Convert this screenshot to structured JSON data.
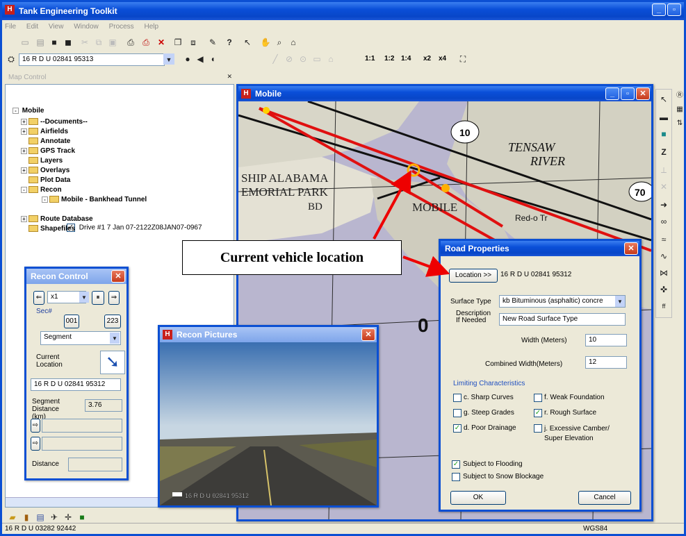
{
  "app": {
    "title": "Tank Engineering Toolkit",
    "menus": [
      "File",
      "Edit",
      "View",
      "Window",
      "Process",
      "Help"
    ]
  },
  "toolbar": {
    "coord_combo": "16 R D U 02841 95313",
    "scale_buttons": [
      "1:1",
      "1:2",
      "1:4",
      "x2",
      "x4"
    ]
  },
  "tree": {
    "header": "Map Control",
    "root": "Mobile",
    "items": [
      {
        "label": "--Documents--",
        "indent": 1,
        "expander": "+"
      },
      {
        "label": "Airfields",
        "indent": 1,
        "expander": "+"
      },
      {
        "label": "Annotate",
        "indent": 1,
        "expander": ""
      },
      {
        "label": "GPS Track",
        "indent": 1,
        "expander": "+"
      },
      {
        "label": "Layers",
        "indent": 1,
        "expander": ""
      },
      {
        "label": "Overlays",
        "indent": 1,
        "expander": "+"
      },
      {
        "label": "Plot Data",
        "indent": 1,
        "expander": ""
      },
      {
        "label": "Recon",
        "indent": 1,
        "expander": "-"
      },
      {
        "label": "Mobile - Bankhead Tunnel",
        "indent": 2,
        "expander": "-"
      },
      {
        "label": "Route Database",
        "indent": 1,
        "expander": "+"
      },
      {
        "label": "Shapefiles",
        "indent": 1,
        "expander": ""
      }
    ],
    "drive_item": "Drive #1 7 Jan 07-2122Z08JAN07-0967"
  },
  "map_window": {
    "title": "Mobile",
    "labels": {
      "route_10": "10",
      "ship": "SHIP ALABAMA",
      "park": "EMORIAL PARK",
      "bd": "BD",
      "mobile": "MOBILE",
      "tensaw": "TENSAW",
      "river": "RIVER",
      "redo": "Red-o Tr",
      "r70": "70",
      "big": "0"
    }
  },
  "callout": {
    "text": "Current vehicle location"
  },
  "recon_control": {
    "title": "Recon Control",
    "speed": "x1",
    "sec_label": "Sec#",
    "sec_start": "001",
    "sec_end": "223",
    "mode": "Segment",
    "current_location_label": "Current Location",
    "location_value": "16 R D U 02841 95312",
    "segment_distance_label": "Segment Distance (km)",
    "segment_distance_value": "3.76",
    "distance_label": "Distance"
  },
  "recon_picture": {
    "title": "Recon Pictures",
    "overlay": "16 R D U 02841 95312"
  },
  "road_props": {
    "title": "Road Properties",
    "location_button": "Location >>",
    "location_value": "16 R D U 02841 95312",
    "surface_type_label": "Surface Type",
    "surface_type_value": "kb Bituminous (asphaltic) concre",
    "description_label": "Description If Needed",
    "description_value": "New Road Surface Type",
    "width_label": "Width (Meters)",
    "width_value": "10",
    "combined_label": "Combined Width(Meters)",
    "combined_value": "12",
    "limiting_title": "Limiting Characteristics",
    "characteristics": [
      {
        "label": "c. Sharp Curves",
        "checked": false
      },
      {
        "label": "f. Weak Foundation",
        "checked": false
      },
      {
        "label": "g. Steep Grades",
        "checked": false
      },
      {
        "label": "r. Rough Surface",
        "checked": true
      },
      {
        "label": "d. Poor Drainage",
        "checked": true
      },
      {
        "label": "j. Excessive Camber/ Super Elevation",
        "checked": false
      }
    ],
    "flooding_label": "Subject to Flooding",
    "flooding_checked": true,
    "snow_label": "Subject to Snow Blockage",
    "snow_checked": false,
    "ok": "OK",
    "cancel": "Cancel"
  },
  "status": {
    "left": "16 R D U 03282 92442",
    "right": "WGS84"
  },
  "colors": {
    "titlebar": "#0a4fd8",
    "route": "#e01010",
    "map_water": "#b9b6cf",
    "callout_arrow": "#ee0000"
  }
}
